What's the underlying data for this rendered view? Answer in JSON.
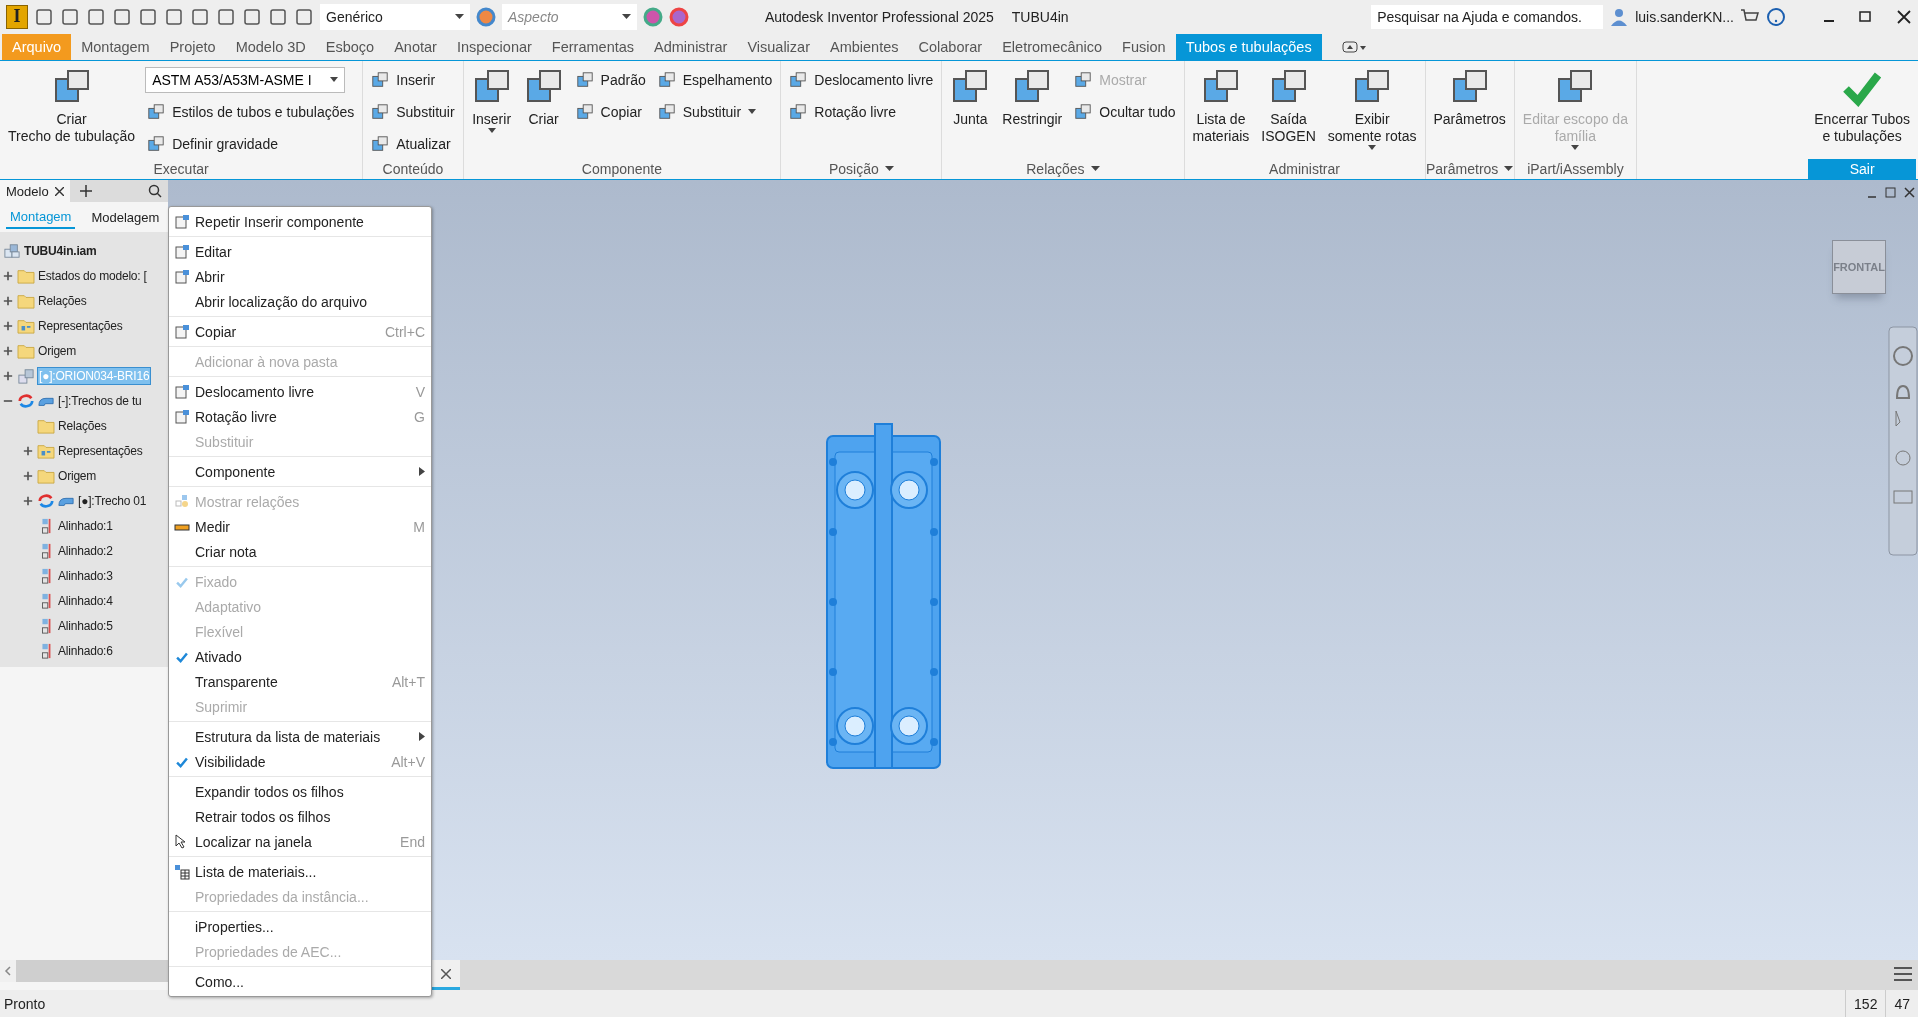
{
  "title_bar": {
    "app_logo": "I",
    "appearance": "Genérico",
    "material_placeholder": "Aspecto",
    "title": "Autodesk Inventor Professional 2025",
    "document": "TUBU4in",
    "search": {
      "placeholder": "Pesquisar na Ajuda e comandos."
    },
    "user": "luis.sanderKN..."
  },
  "ribbon_tabs": [
    {
      "label": "Arquivo",
      "kind": "file",
      "selected": false
    },
    {
      "label": "Montagem",
      "kind": "tab",
      "selected": false
    },
    {
      "label": "Projeto",
      "kind": "tab",
      "selected": false
    },
    {
      "label": "Modelo 3D",
      "kind": "tab",
      "selected": false
    },
    {
      "label": "Esboço",
      "kind": "tab",
      "selected": false
    },
    {
      "label": "Anotar",
      "kind": "tab",
      "selected": false
    },
    {
      "label": "Inspecionar",
      "kind": "tab",
      "selected": false
    },
    {
      "label": "Ferramentas",
      "kind": "tab",
      "selected": false
    },
    {
      "label": "Administrar",
      "kind": "tab",
      "selected": false
    },
    {
      "label": "Visualizar",
      "kind": "tab",
      "selected": false
    },
    {
      "label": "Ambientes",
      "kind": "tab",
      "selected": false
    },
    {
      "label": "Colaborar",
      "kind": "tab",
      "selected": false
    },
    {
      "label": "Eletromecânico",
      "kind": "tab",
      "selected": false
    },
    {
      "label": "Fusion",
      "kind": "tab",
      "selected": false
    },
    {
      "label": "Tubos e tubulações",
      "kind": "tab",
      "selected": true
    }
  ],
  "ribbon_panels": [
    {
      "title": "Executar",
      "menu": false,
      "highlighted": false,
      "columns": [
        [
          {
            "kind": "large",
            "label": "Criar\nTrecho de tubulação",
            "disabled": false,
            "caret": false
          }
        ],
        [
          {
            "kind": "dropdown",
            "label": "ASTM A53/A53M-ASME I",
            "disabled": false,
            "caret": true
          },
          {
            "kind": "small",
            "label": "Estilos de tubos e tubulações",
            "disabled": false,
            "caret": false
          },
          {
            "kind": "small",
            "label": "Definir gravidade",
            "disabled": false,
            "caret": false
          }
        ]
      ]
    },
    {
      "title": "Conteúdo",
      "menu": false,
      "highlighted": false,
      "columns": [
        [
          {
            "kind": "small",
            "label": "Inserir",
            "disabled": false,
            "caret": false
          },
          {
            "kind": "small",
            "label": "Substituir",
            "disabled": false,
            "caret": false
          },
          {
            "kind": "small",
            "label": "Atualizar",
            "disabled": false,
            "caret": false
          }
        ]
      ]
    },
    {
      "title": "Componente",
      "menu": false,
      "highlighted": false,
      "columns": [
        [
          {
            "kind": "large",
            "label": "Inserir",
            "disabled": false,
            "caret": true
          }
        ],
        [
          {
            "kind": "large",
            "label": "Criar",
            "disabled": false,
            "caret": false
          }
        ],
        [
          {
            "kind": "small",
            "label": "Padrão",
            "disabled": false,
            "caret": false
          },
          {
            "kind": "small",
            "label": "Copiar",
            "disabled": false,
            "caret": false
          }
        ],
        [
          {
            "kind": "small",
            "label": "Espelhamento",
            "disabled": false,
            "caret": false
          },
          {
            "kind": "small",
            "label": "Substituir",
            "disabled": false,
            "caret": true
          }
        ]
      ]
    },
    {
      "title": "Posição",
      "menu": true,
      "highlighted": false,
      "columns": [
        [
          {
            "kind": "small",
            "label": "Deslocamento livre",
            "disabled": false,
            "caret": false
          },
          {
            "kind": "small",
            "label": "Rotação livre",
            "disabled": false,
            "caret": false
          }
        ]
      ]
    },
    {
      "title": "Relações",
      "menu": true,
      "highlighted": false,
      "columns": [
        [
          {
            "kind": "large",
            "label": "Junta",
            "disabled": false,
            "caret": false
          }
        ],
        [
          {
            "kind": "large",
            "label": "Restringir",
            "disabled": false,
            "caret": false
          }
        ],
        [
          {
            "kind": "small",
            "label": "Mostrar",
            "disabled": true,
            "caret": false
          },
          {
            "kind": "small",
            "label": "Ocultar tudo",
            "disabled": false,
            "caret": false
          }
        ]
      ]
    },
    {
      "title": "Administrar",
      "menu": false,
      "highlighted": false,
      "columns": [
        [
          {
            "kind": "large",
            "label": "Lista de\nmateriais",
            "disabled": false,
            "caret": false
          }
        ],
        [
          {
            "kind": "large",
            "label": "Saída\nISOGEN",
            "disabled": false,
            "caret": false
          }
        ],
        [
          {
            "kind": "large",
            "label": "Exibir\nsomente rotas",
            "disabled": false,
            "caret": true
          }
        ]
      ]
    },
    {
      "title": "Parâmetros",
      "menu": true,
      "highlighted": false,
      "columns": [
        [
          {
            "kind": "large",
            "label": "Parâmetros",
            "disabled": false,
            "caret": false
          }
        ]
      ]
    },
    {
      "title": "iPart/iAssembly",
      "menu": false,
      "highlighted": false,
      "columns": [
        [
          {
            "kind": "large",
            "label": "Editar escopo da\nfamília",
            "disabled": true,
            "caret": true
          }
        ]
      ]
    },
    {
      "title": "Sair",
      "menu": false,
      "highlighted": true,
      "columns": [
        [
          {
            "kind": "large",
            "label": "Encerrar Tubos\ne tubulações",
            "disabled": false,
            "caret": false
          }
        ]
      ]
    }
  ],
  "browser": {
    "title": "Modelo",
    "tabs": [
      {
        "label": "Montagem",
        "selected": true
      },
      {
        "label": "Modelagem",
        "selected": false
      }
    ],
    "tree": [
      {
        "label": "TUBU4in.iam",
        "kind": "assembly",
        "children": [
          {
            "label": "Estados do modelo: [",
            "kind": "folder",
            "expanded": false,
            "selected": false
          },
          {
            "label": "Relações",
            "kind": "folder",
            "expanded": false,
            "selected": false
          },
          {
            "label": "Representações",
            "kind": "representations",
            "expanded": false,
            "selected": false
          },
          {
            "label": "Origem",
            "kind": "folder",
            "expanded": false,
            "selected": false
          },
          {
            "label": "[●]:ORION034-BRI16",
            "kind": "part",
            "expanded": false,
            "selected": true
          },
          {
            "label": "[-]:Trechos de tu",
            "kind": "pipe_run",
            "expanded": true,
            "selected": false,
            "children": [
              {
                "label": "Relações",
                "kind": "folder",
                "selected": false
              },
              {
                "label": "Representações",
                "kind": "representations",
                "expanded": false,
                "selected": false
              },
              {
                "label": "Origem",
                "kind": "folder",
                "expanded": false,
                "selected": false
              },
              {
                "label": "[●]:Trecho 01",
                "kind": "pipe_run",
                "expanded": false,
                "selected": false
              },
              {
                "label": "Alinhado:1",
                "kind": "constraint",
                "selected": false
              },
              {
                "label": "Alinhado:2",
                "kind": "constraint",
                "selected": false
              },
              {
                "label": "Alinhado:3",
                "kind": "constraint",
                "selected": false
              },
              {
                "label": "Alinhado:4",
                "kind": "constraint",
                "selected": false
              },
              {
                "label": "Alinhado:5",
                "kind": "constraint",
                "selected": false
              },
              {
                "label": "Alinhado:6",
                "kind": "constraint",
                "selected": false
              }
            ]
          }
        ]
      }
    ]
  },
  "context_menu": {
    "groups": [
      {
        "items": [
          {
            "label": "Repetir Inserir componente",
            "disabled": false,
            "checked": false
          }
        ]
      },
      {
        "items": [
          {
            "label": "Editar",
            "disabled": false,
            "checked": false
          },
          {
            "label": "Abrir",
            "disabled": false,
            "checked": false
          },
          {
            "label": "Abrir localização do arquivo",
            "disabled": false,
            "checked": false
          }
        ]
      },
      {
        "items": [
          {
            "label": "Copiar",
            "shortcut": "Ctrl+C",
            "disabled": false,
            "checked": false
          }
        ]
      },
      {
        "items": [
          {
            "label": "Adicionar à nova pasta",
            "disabled": true,
            "checked": false
          }
        ]
      },
      {
        "items": [
          {
            "label": "Deslocamento livre",
            "shortcut": "V",
            "disabled": false,
            "checked": false
          },
          {
            "label": "Rotação livre",
            "shortcut": "G",
            "disabled": false,
            "checked": false
          },
          {
            "label": "Substituir",
            "disabled": true,
            "checked": false
          }
        ]
      },
      {
        "items": [
          {
            "label": "Componente",
            "submenu": true,
            "disabled": false,
            "checked": false
          }
        ]
      },
      {
        "items": [
          {
            "label": "Mostrar relações",
            "disabled": true,
            "checked": false
          },
          {
            "label": "Medir",
            "shortcut": "M",
            "disabled": false,
            "checked": false
          },
          {
            "label": "Criar nota",
            "disabled": false,
            "checked": false
          }
        ]
      },
      {
        "items": [
          {
            "label": "Fixado",
            "disabled": true,
            "checked": true
          },
          {
            "label": "Adaptativo",
            "disabled": true,
            "checked": false
          },
          {
            "label": "Flexível",
            "disabled": true,
            "checked": false
          },
          {
            "label": "Ativado",
            "disabled": false,
            "checked": true
          },
          {
            "label": "Transparente",
            "shortcut": "Alt+T",
            "disabled": false,
            "checked": false
          },
          {
            "label": "Suprimir",
            "disabled": true,
            "checked": false
          }
        ]
      },
      {
        "items": [
          {
            "label": "Estrutura da lista de materiais",
            "submenu": true,
            "disabled": false,
            "checked": false
          },
          {
            "label": "Visibilidade",
            "shortcut": "Alt+V",
            "disabled": false,
            "checked": true
          }
        ]
      },
      {
        "items": [
          {
            "label": "Expandir todos os filhos",
            "disabled": false,
            "checked": false
          },
          {
            "label": "Retrair todos os filhos",
            "disabled": false,
            "checked": false
          },
          {
            "label": "Localizar na janela",
            "shortcut": "End",
            "disabled": false,
            "checked": false
          }
        ]
      },
      {
        "items": [
          {
            "label": "Lista de materiais...",
            "disabled": false,
            "checked": false
          },
          {
            "label": "Propriedades da instância...",
            "disabled": true,
            "checked": false
          }
        ]
      },
      {
        "items": [
          {
            "label": "iProperties...",
            "disabled": false,
            "checked": false
          },
          {
            "label": "Propriedades de AEC...",
            "disabled": true,
            "checked": false
          }
        ]
      },
      {
        "items": [
          {
            "label": "Como...",
            "disabled": false,
            "checked": false
          }
        ]
      }
    ]
  },
  "viewport": {
    "view_cube": "FRONTAL"
  },
  "status_bar": {
    "message": "Pronto",
    "counts": [
      "152",
      "47"
    ]
  }
}
